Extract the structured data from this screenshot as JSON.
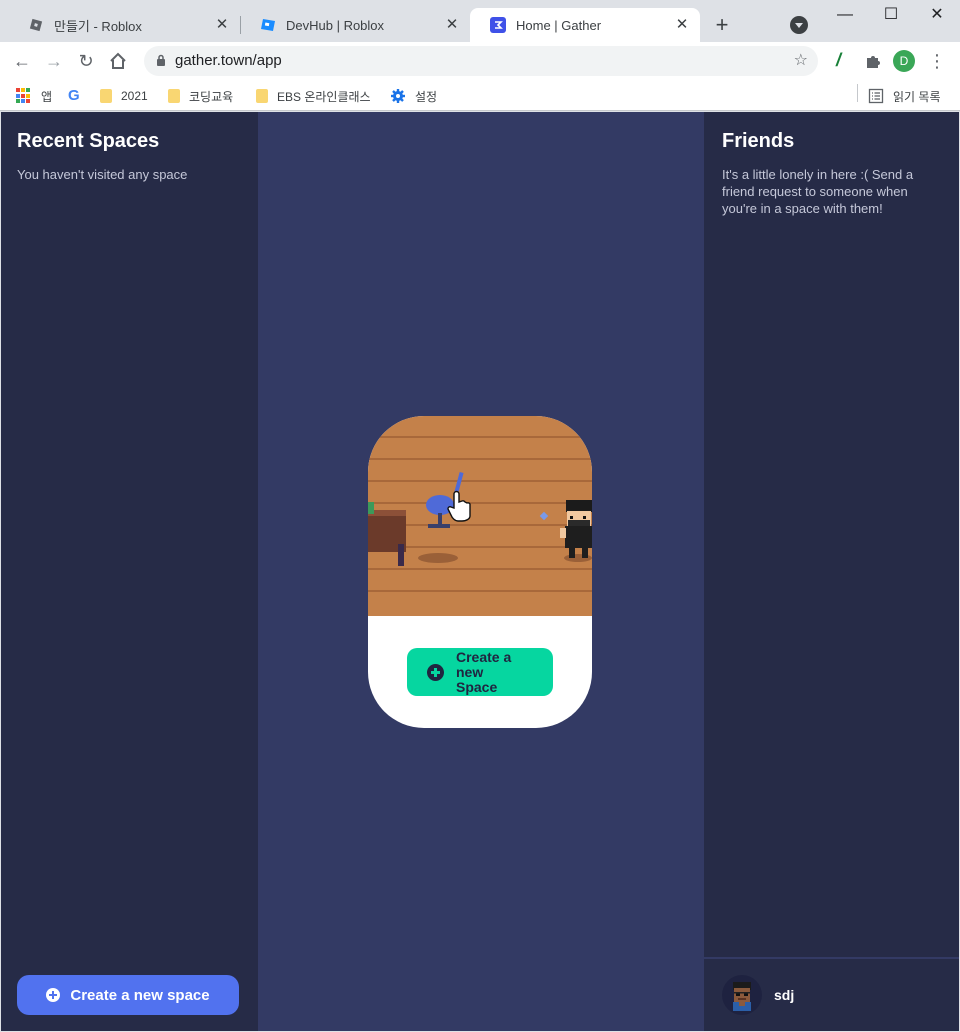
{
  "browser": {
    "tabs": [
      {
        "label": "만들기 - Roblox",
        "active": false
      },
      {
        "label": "DevHub | Roblox",
        "active": false
      },
      {
        "label": "Home | Gather",
        "active": true
      }
    ],
    "url": "gather.town/app",
    "profile_initial": "D"
  },
  "bookmarks": [
    {
      "label": "앱",
      "icon": "apps-grid-icon"
    },
    {
      "label": "",
      "icon": "google-icon"
    },
    {
      "label": "2021",
      "icon": "folder-icon"
    },
    {
      "label": "코딩교육",
      "icon": "folder-icon"
    },
    {
      "label": "EBS 온라인클래스",
      "icon": "folder-icon"
    },
    {
      "label": "설정",
      "icon": "gear-icon"
    }
  ],
  "reading_list": "읽기 목록",
  "recent_spaces": {
    "title": "Recent Spaces",
    "empty_text": "You haven't visited any space",
    "create_button": "Create a new space"
  },
  "center_card": {
    "create_button": "Create a new Space"
  },
  "friends": {
    "title": "Friends",
    "empty_text": "It's a little lonely in here :( Send a friend request to someone when you're in a space with them!"
  },
  "user": {
    "name": "sdj"
  },
  "colors": {
    "panel_bg": "#262b47",
    "center_bg": "#333a64",
    "primary_button": "#5172ef",
    "accent_button": "#06d6a0",
    "floor": "#c4814a"
  }
}
